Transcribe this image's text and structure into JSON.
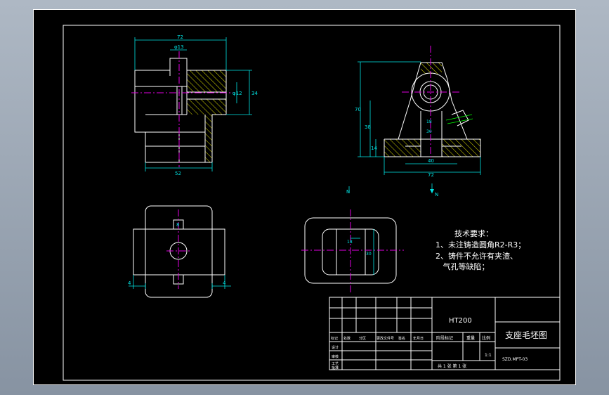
{
  "title_block": {
    "material": "HT200",
    "drawing_name": "支座毛坯图",
    "drawing_number": "SZD.MPT-03",
    "scale": "1:1",
    "revision_labels": [
      "标记",
      "处数",
      "分区",
      "更改文件号",
      "签名",
      "年月日"
    ],
    "row_labels": [
      "设计",
      "审核",
      "工艺",
      "批准"
    ],
    "stage_label": "阶段标记",
    "weight_label": "重量",
    "scale_label": "比例",
    "sheet_label": "共 1 张 第 1 张"
  },
  "tech_requirements": {
    "heading": "技术要求：",
    "items": [
      "1、未注铸造圆角R2-R3；",
      "2、铸件不允许有夹渣、",
      "   气孔等缺陷；"
    ]
  },
  "dimensions": {
    "front_top": "72",
    "front_hole": "φ13",
    "front_right_a": "φ12",
    "front_right_b": "34",
    "front_bottom": "52",
    "side_height_total": "70",
    "side_height_mid": "38",
    "side_height_small": "14",
    "side_bottom_inner": "40",
    "side_bottom_total": "72",
    "plan_hole": "8",
    "plan_left": "4",
    "plan_right": "4",
    "small_a": "18",
    "small_b": "30",
    "view_mark_a": "N",
    "view_mark_b": "N"
  },
  "colors": {
    "background": "#000000",
    "outline": "#ffffff",
    "dimension": "#00e5e5",
    "centerline": "#e000e0",
    "hatch": "#e5e500"
  }
}
